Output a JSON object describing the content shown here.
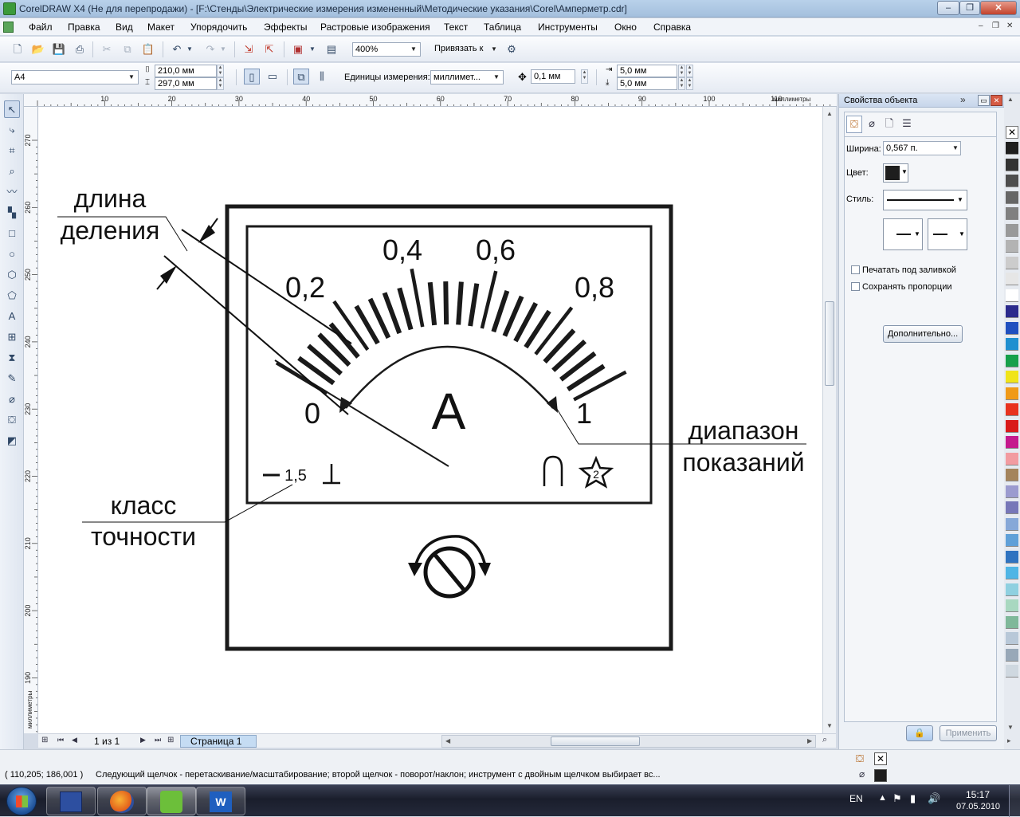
{
  "window": {
    "title": "CorelDRAW X4 (Не для перепродажи) - [F:\\Стенды\\Электрические измерения измененный\\Методические указания\\Corel\\Амперметр.cdr]",
    "minimize": "–",
    "restore": "❐",
    "close": "✕"
  },
  "menu": {
    "items": [
      "Файл",
      "Правка",
      "Вид",
      "Макет",
      "Упорядочить",
      "Эффекты",
      "Растровые изображения",
      "Текст",
      "Таблица",
      "Инструменты",
      "Окно",
      "Справка"
    ]
  },
  "toolbar": {
    "zoom": "400%",
    "snap_label": "Привязать к"
  },
  "propbar": {
    "page_size": "A4",
    "width": "210,0 мм",
    "height": "297,0 мм",
    "units_label": "Единицы измерения:",
    "units_value": "миллимет...",
    "nudge": "0,1 мм",
    "dup_x": "5,0 мм",
    "dup_y": "5,0 мм"
  },
  "ruler": {
    "h_ticks": [
      "10",
      "20",
      "30",
      "40",
      "50",
      "60",
      "70",
      "80",
      "90",
      "100",
      "110"
    ],
    "h_unit": "миллиметры",
    "v_ticks": [
      "270",
      "260",
      "250",
      "240",
      "230",
      "220",
      "210",
      "200",
      "190"
    ],
    "v_unit": "миллиметры"
  },
  "drawing": {
    "scale_labels": [
      "0",
      "0,2",
      "0,4",
      "0,6",
      "0,8",
      "1"
    ],
    "unit_symbol": "A",
    "accuracy_class": "1,5",
    "star_number": "2",
    "callout_division_1": "длина",
    "callout_division_2": "деления",
    "callout_range_1": "диапазон",
    "callout_range_2": "показаний",
    "callout_class_1": "класс",
    "callout_class_2": "точности"
  },
  "page_nav": {
    "page_count": "1 из 1",
    "page_tab": "Страница 1"
  },
  "docker": {
    "title": "Свойства объекта",
    "width_label": "Ширина:",
    "width_value": "0,567 п.",
    "color_label": "Цвет:",
    "style_label": "Стиль:",
    "behind_fill": "Печатать под заливкой",
    "scale_with_image": "Сохранять пропорции",
    "advanced_button": "Дополнительно...",
    "apply_button": "Применить"
  },
  "palette": {
    "colors": [
      "#1e1e1e",
      "#333333",
      "#4d4d4d",
      "#666666",
      "#808080",
      "#999999",
      "#b3b3b3",
      "#cccccc",
      "#e6e6e6",
      "#ffffff",
      "#2b2a8c",
      "#1f4fbf",
      "#1f8fd0",
      "#16a04a",
      "#f0e419",
      "#f09a18",
      "#e8321e",
      "#d91a1a",
      "#c5198d",
      "#f29ba0",
      "#a4845c",
      "#9b9bcf",
      "#7777b8",
      "#86a8d8",
      "#5fa0d8",
      "#2f73c0",
      "#4fb5e5",
      "#8fd0e0",
      "#a8d8c0",
      "#7fb89a",
      "#b8c8d8",
      "#98a8b8",
      "#cfd8e0"
    ]
  },
  "status": {
    "coords": "( 110,205; 186,001 )",
    "hint": "Следующий щелчок - перетаскивание/масштабирование; второй щелчок - поворот/наклон; инструмент с двойным щелчком выбирает вс..."
  },
  "taskbar": {
    "lang": "EN",
    "time": "15:17",
    "date": "07.05.2010"
  }
}
